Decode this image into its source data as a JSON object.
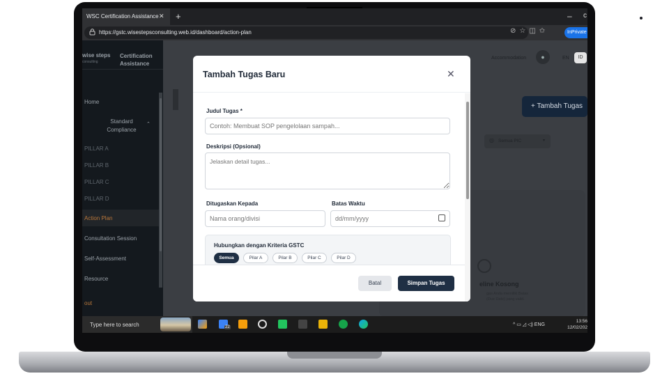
{
  "browser": {
    "tab_title": "WSC Certification Assistance",
    "tab_close": "✕",
    "new_tab": "+",
    "url": "https://gstc.wisestepsconsulting.web.id/dashboard/action-plan",
    "inprivate": "InPrivate",
    "minimize": "–",
    "close": "c"
  },
  "sidebar": {
    "brand_name": "wise steps",
    "brand_sub": "consulting",
    "brand_title_1": "Certification",
    "brand_title_2": "Assistance",
    "items": [
      {
        "label": "Home"
      },
      {
        "label": "Standard"
      },
      {
        "label": "Compliance"
      },
      {
        "label": "PILLAR A"
      },
      {
        "label": "PILLAR B"
      },
      {
        "label": "PILLAR C"
      },
      {
        "label": "PILLAR D"
      },
      {
        "label": "Action Plan"
      },
      {
        "label": "Consultation Session"
      },
      {
        "label": "Self-Assessment"
      },
      {
        "label": "Resource"
      },
      {
        "label": "out"
      }
    ]
  },
  "header": {
    "accommodation": "Accommodation",
    "lang_en": "EN",
    "lang_id": "ID"
  },
  "background": {
    "add_task_button": "+ Tambah Tugas",
    "pic_filter": "Semua PIC",
    "empty_title": "eline Kosong",
    "empty_sub_1": "gas Anda memiliki Batas",
    "empty_sub_2": "(Due Date) yang valid."
  },
  "modal": {
    "title": "Tambah Tugas Baru",
    "close": "✕",
    "fields": {
      "title_label": "Judul Tugas *",
      "title_placeholder": "Contoh: Membuat SOP pengelolaan sampah...",
      "desc_label": "Deskripsi (Opsional)",
      "desc_placeholder": "Jelaskan detail tugas...",
      "assignee_label": "Ditugaskan Kepada",
      "assignee_placeholder": "Nama orang/divisi",
      "deadline_label": "Batas Waktu",
      "deadline_placeholder": "dd/mm/yyyy"
    },
    "gstc": {
      "label": "Hubungkan dengan Kriteria GSTC",
      "chips": [
        "Semua",
        "Pilar A",
        "Pilar B",
        "Pilar C",
        "Pilar D"
      ],
      "active": "Semua"
    },
    "cancel": "Batal",
    "save": "Simpan Tugas"
  },
  "taskbar": {
    "search": "Type here to search",
    "badge": "22",
    "lang": "ENG",
    "time": "13:56",
    "date": "12/02/202"
  }
}
